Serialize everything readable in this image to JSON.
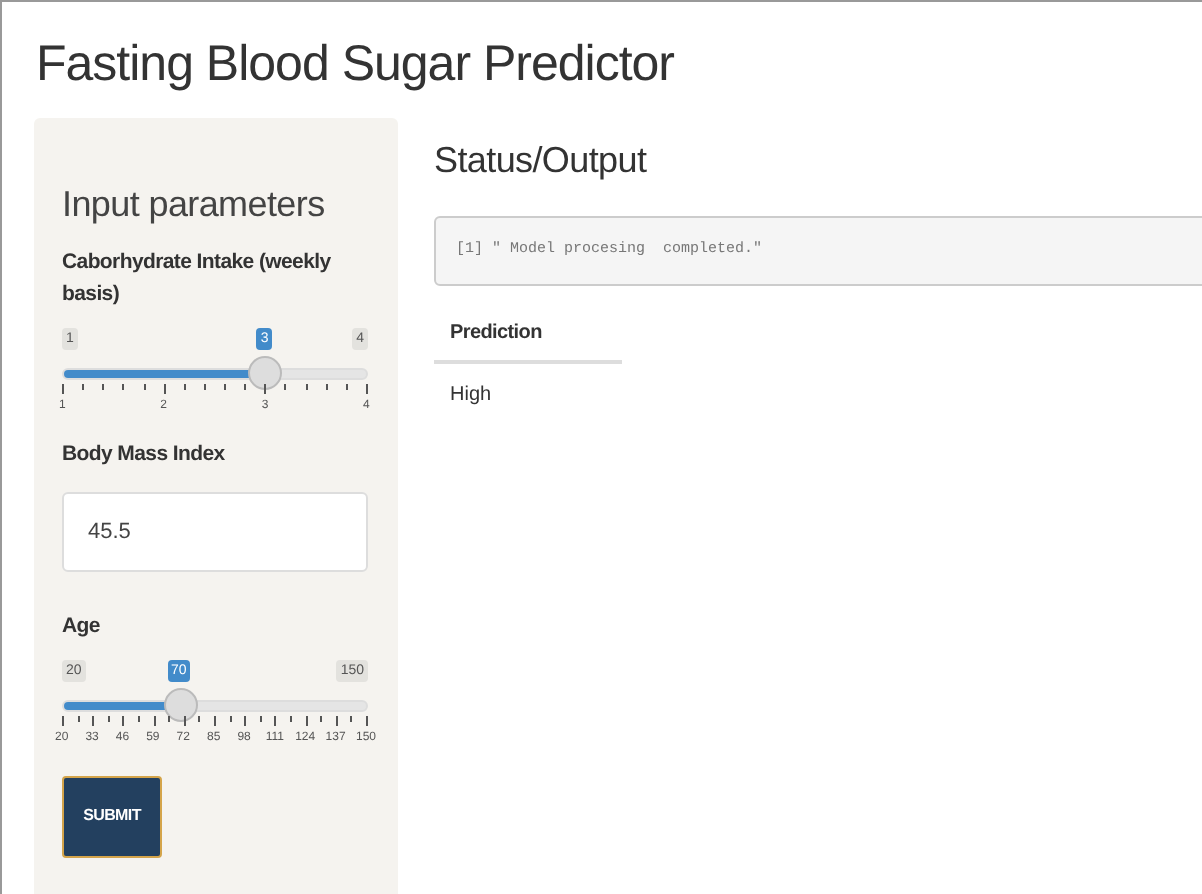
{
  "title": "Fasting Blood Sugar Predictor",
  "sidebar": {
    "heading": "Input parameters",
    "inputs": [
      {
        "kind": "slider",
        "label": "Caborhydrate Intake (weekly basis)",
        "min": "1",
        "max": "4",
        "value": "3",
        "level": 0.667,
        "ticks": [
          "1",
          "2",
          "3",
          "4"
        ]
      },
      {
        "kind": "number",
        "label": "Body Mass Index",
        "value": "45.5"
      },
      {
        "kind": "slider",
        "label": "Age",
        "min": "20",
        "max": "150",
        "value": "70",
        "level": 0.385,
        "ticks": [
          "20",
          "33",
          "46",
          "59",
          "72",
          "85",
          "98",
          "111",
          "124",
          "137",
          "150"
        ]
      }
    ],
    "button": "SUBMIT"
  },
  "main": {
    "heading": "Status/Output",
    "output": "[1] \" Model procesing  completed.\"",
    "table": {
      "columns": [
        "Prediction"
      ],
      "rows": [
        [
          "High"
        ]
      ]
    }
  }
}
